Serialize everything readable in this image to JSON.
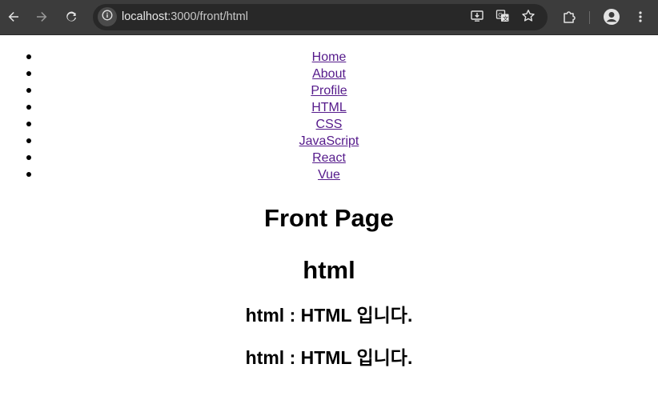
{
  "browser": {
    "url_host": "localhost",
    "url_path": ":3000/front/html",
    "icons": {
      "back": "back-arrow-icon",
      "forward": "forward-arrow-icon",
      "reload": "reload-icon",
      "site_info": "info-icon",
      "install": "install-app-icon",
      "translate": "translate-icon",
      "bookmark": "star-icon",
      "extensions": "puzzle-icon",
      "profile": "avatar-icon",
      "menu": "kebab-menu-icon"
    }
  },
  "nav": {
    "items": [
      {
        "label": "Home"
      },
      {
        "label": "About"
      },
      {
        "label": "Profile"
      },
      {
        "label": "HTML"
      },
      {
        "label": "CSS"
      },
      {
        "label": "JavaScript"
      },
      {
        "label": "React"
      },
      {
        "label": "Vue"
      }
    ]
  },
  "main": {
    "page_title": "Front Page",
    "section_title": "html",
    "line_1": "html : HTML 입니다.",
    "line_2": "html : HTML 입니다."
  },
  "colors": {
    "link": "#551a8b",
    "toolbar": "#3c3c3c",
    "omnibox": "#282828"
  }
}
